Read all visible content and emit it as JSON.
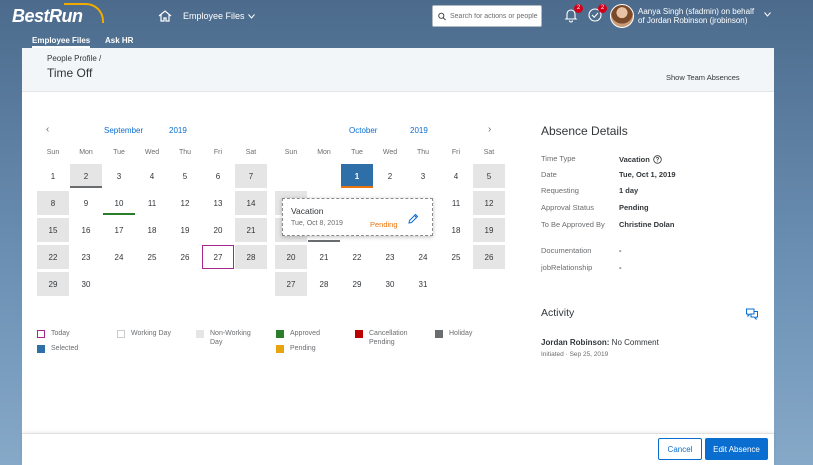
{
  "shell": {
    "logo_text": "BestRun",
    "module_label": "Employee Files",
    "search_placeholder": "Search for actions or people",
    "notifications_count": "2",
    "approvals_count": "2",
    "user_line1": "Aanya Singh (sfadmin) on behalf",
    "user_line2": "of Jordan Robinson (jrobinson)"
  },
  "subnav": {
    "items": [
      "Employee Files",
      "Ask HR"
    ]
  },
  "header": {
    "breadcrumb": "People Profile /",
    "title": "Time Off",
    "team_link": "Show Team Absences"
  },
  "calendar": {
    "weekdays": [
      "Sun",
      "Mon",
      "Tue",
      "Wed",
      "Thu",
      "Fri",
      "Sat"
    ],
    "months": [
      {
        "name": "September",
        "year": "2019"
      },
      {
        "name": "October",
        "year": "2019"
      }
    ],
    "colors": {
      "nonworking": "#e5e5e5",
      "selected": "#2f6fa8",
      "today": "#a3288f",
      "approved": "#2b7d2b",
      "pending": "#e9730c",
      "cancellation": "#bb0000",
      "holiday": "#6a6d70"
    }
  },
  "popover": {
    "title": "Vacation",
    "date": "Tue, Oct 8, 2019",
    "status": "Pending"
  },
  "legend": {
    "today": "Today",
    "working": "Working Day",
    "nonworking_1": "Non-Working",
    "nonworking_2": "Day",
    "approved": "Approved",
    "cancellation_1": "Cancellation",
    "cancellation_2": "Pending",
    "holiday": "Holiday",
    "selected": "Selected",
    "pending": "Pending"
  },
  "details": {
    "title": "Absence Details",
    "rows": [
      {
        "label": "Time Type",
        "value": "Vacation"
      },
      {
        "label": "Date",
        "value": "Tue, Oct 1, 2019"
      },
      {
        "label": "Requesting",
        "value": "1 day"
      },
      {
        "label": "Approval Status",
        "value": "Pending"
      },
      {
        "label": "To Be Approved By",
        "value": "Christine Dolan"
      },
      {
        "label": "Documentation",
        "value": "-"
      },
      {
        "label": "jobRelationship",
        "value": "-"
      }
    ]
  },
  "activity": {
    "title": "Activity",
    "author": "Jordan Robinson:",
    "comment": " No Comment",
    "status": "Initiated",
    "separator": "·",
    "date": "Sep 25, 2019"
  },
  "footer": {
    "cancel": "Cancel",
    "edit": "Edit Absence"
  }
}
